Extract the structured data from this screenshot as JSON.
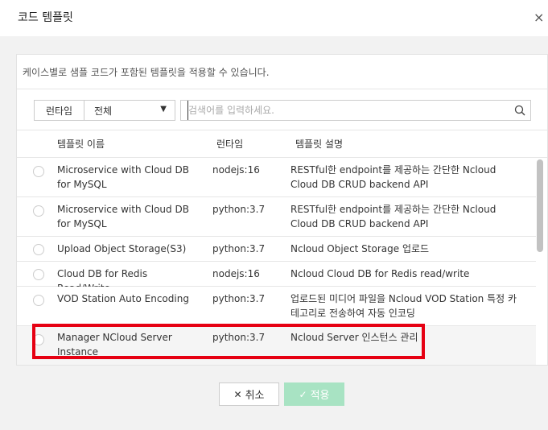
{
  "dialog": {
    "title": "코드 템플릿",
    "close_glyph": "×"
  },
  "description": "케이스별로 샘플 코드가 포함된 템플릿을 적용할 수 있습니다.",
  "filter": {
    "runtime_label": "런타임",
    "runtime_value": "전체",
    "arrow_glyph": "▼",
    "search_placeholder": "검색어를 입력하세요."
  },
  "table": {
    "headers": {
      "name": "템플릿 이름",
      "runtime": "런타임",
      "desc": "템플릿 설명"
    },
    "rows": [
      {
        "name": "Microservice with Cloud DB for MySQL",
        "runtime": "nodejs:16",
        "desc": "RESTful한 endpoint를 제공하는 간단한 Ncloud Cloud DB CRUD backend API"
      },
      {
        "name": "Microservice with Cloud DB for MySQL",
        "runtime": "python:3.7",
        "desc": "RESTful한 endpoint를 제공하는 간단한 Ncloud Cloud DB CRUD backend API"
      },
      {
        "name": "Upload Object Storage(S3)",
        "runtime": "python:3.7",
        "desc": "Ncloud Object Storage 업로드"
      },
      {
        "name": "Cloud DB for Redis Read/Write",
        "runtime": "nodejs:16",
        "desc": "Ncloud Cloud DB for Redis read/write"
      },
      {
        "name": "VOD Station Auto Encoding",
        "runtime": "python:3.7",
        "desc": "업로드된 미디어 파일을 Ncloud VOD Station 특정 카테고리로 전송하여 자동 인코딩"
      },
      {
        "name": "Manager NCloud Server Instance",
        "runtime": "python:3.7",
        "desc": "Ncloud Server 인스턴스 관리"
      }
    ]
  },
  "buttons": {
    "cancel": "취소",
    "cancel_glyph": "✕",
    "apply": "적용",
    "apply_glyph": "✓"
  },
  "colors": {
    "apply_bg": "#a8e3c3",
    "highlight_border": "#e60012"
  }
}
